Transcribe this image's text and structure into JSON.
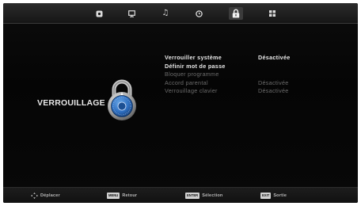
{
  "tabs": [
    {
      "icon": "picture-icon"
    },
    {
      "icon": "tv-icon"
    },
    {
      "icon": "music-icon"
    },
    {
      "icon": "clock-icon"
    },
    {
      "icon": "lock-icon",
      "active": true
    },
    {
      "icon": "grid-icon"
    }
  ],
  "panel": {
    "title": "VERROUILLAGE"
  },
  "menu": [
    {
      "label": "Verrouiller système",
      "value": "Désactivée"
    },
    {
      "label": "Définir mot de passe",
      "value": ""
    },
    {
      "label": "Bloquer programme",
      "value": ""
    },
    {
      "label": "Accord parental",
      "value": "Désactivée"
    },
    {
      "label": "Verrouillage clavier",
      "value": "Désactivée"
    }
  ],
  "hints": {
    "move_label": "Déplacer",
    "back_key": "MENU",
    "back_label": "Retour",
    "select_key": "ENTER",
    "select_label": "Sélection",
    "exit_key": "EXIT",
    "exit_label": "Sortie"
  },
  "colors": {
    "background": "#0a0a0a",
    "text": "#e9e9e9",
    "dim_text": "#6c6c6c",
    "accent": "#2f6fc0"
  }
}
